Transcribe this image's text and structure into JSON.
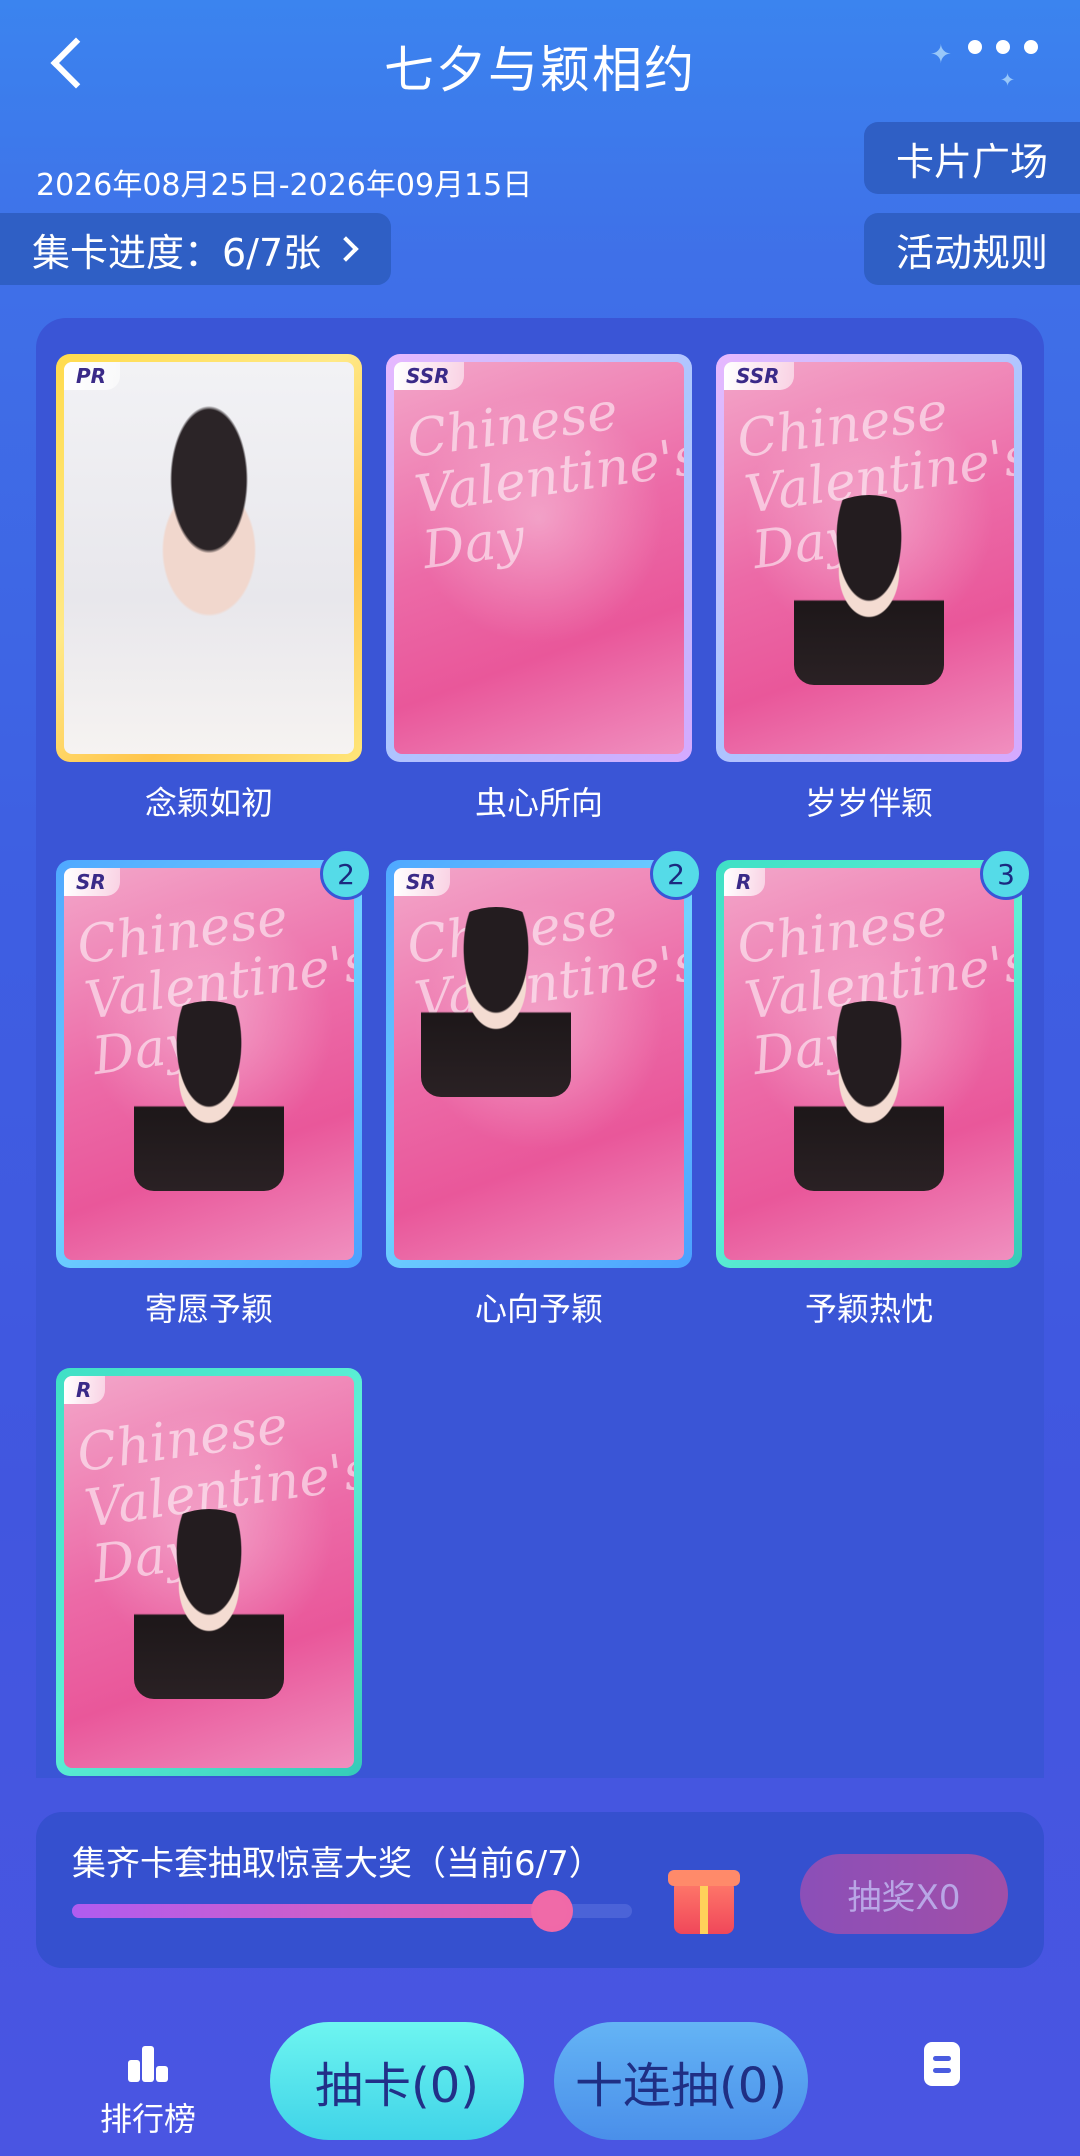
{
  "header": {
    "title": "七夕与颖相约"
  },
  "date_range": "2026年08月25日-2026年09月15日",
  "progress_label": "集卡进度：6/7张",
  "buttons": {
    "card_square": "卡片广场",
    "rules": "活动规则"
  },
  "cards": [
    {
      "name": "念颖如初",
      "rarity": "PR",
      "count": ""
    },
    {
      "name": "虫心所向",
      "rarity": "SSR",
      "count": ""
    },
    {
      "name": "岁岁伴颖",
      "rarity": "SSR",
      "count": ""
    },
    {
      "name": "寄愿予颖",
      "rarity": "SR",
      "count": "2"
    },
    {
      "name": "心向予颖",
      "rarity": "SR",
      "count": "2"
    },
    {
      "name": "予颖热忱",
      "rarity": "R",
      "count": "3"
    },
    {
      "name": "",
      "rarity": "R",
      "count": ""
    }
  ],
  "card_art_text": "Chinese Valentine's Day",
  "lottery": {
    "title": "集齐卡套抽取惊喜大奖（当前6/7）",
    "progress_fraction": 0.857,
    "button": "抽奖X0"
  },
  "bottom": {
    "ranking": "排行榜",
    "draw_one": "抽卡(0)",
    "draw_ten": "十连抽(0)"
  },
  "colors": {
    "pr_frame": "#ffd84a",
    "ssr_frame": "#c9b5ff",
    "sr_frame": "#5ab8ff",
    "r_frame": "#44e0c8"
  }
}
